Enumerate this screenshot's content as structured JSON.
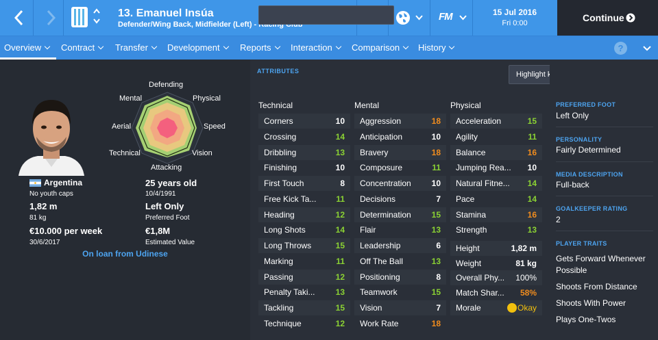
{
  "header": {
    "player_title": "13. Emanuel Insúa",
    "player_subtitle": "Defender/Wing Back, Midfielder (Left) - Racing Club",
    "date": "15 Jul 2016",
    "time": "Fri 0:00",
    "continue_label": "Continue",
    "fm_logo": "FM",
    "colors": {
      "header_bg": "#3f96e8",
      "accent": "#4da4f0",
      "orange": "#f08c1e",
      "green": "#8bd233"
    }
  },
  "nav": {
    "items": [
      "Overview",
      "Contract",
      "Transfer",
      "Development",
      "Reports",
      "Interaction",
      "Comparison",
      "History"
    ],
    "help": "?"
  },
  "profile": {
    "nationality": "Argentina",
    "youth_caps": "No youth caps",
    "height": "1,82 m",
    "weight": "81 kg",
    "wage": "€10.000 per week",
    "contract_end": "30/6/2017",
    "age": "25 years old",
    "dob": "10/4/1991",
    "preferred_foot": "Left Only",
    "preferred_foot_label": "Preferred Foot",
    "value": "€1,8M",
    "value_label": "Estimated Value",
    "loan": "On loan from Udinese"
  },
  "radar": {
    "labels": [
      "Defending",
      "Physical",
      "Speed",
      "Vision",
      "Attacking",
      "Technical",
      "Aerial",
      "Mental"
    ]
  },
  "attributes": {
    "section_title": "ATTRIBUTES",
    "highlight_button": "Highlight key attributes for role",
    "technical": {
      "title": "Technical",
      "rows": [
        {
          "name": "Corners",
          "value": "10"
        },
        {
          "name": "Crossing",
          "value": "14"
        },
        {
          "name": "Dribbling",
          "value": "13"
        },
        {
          "name": "Finishing",
          "value": "10"
        },
        {
          "name": "First Touch",
          "value": "8"
        },
        {
          "name": "Free Kick Ta...",
          "value": "11"
        },
        {
          "name": "Heading",
          "value": "12"
        },
        {
          "name": "Long Shots",
          "value": "14"
        },
        {
          "name": "Long Throws",
          "value": "15"
        },
        {
          "name": "Marking",
          "value": "11"
        },
        {
          "name": "Passing",
          "value": "12"
        },
        {
          "name": "Penalty Taki...",
          "value": "13"
        },
        {
          "name": "Tackling",
          "value": "15"
        },
        {
          "name": "Technique",
          "value": "12"
        }
      ]
    },
    "mental": {
      "title": "Mental",
      "rows": [
        {
          "name": "Aggression",
          "value": "18"
        },
        {
          "name": "Anticipation",
          "value": "10"
        },
        {
          "name": "Bravery",
          "value": "18"
        },
        {
          "name": "Composure",
          "value": "11"
        },
        {
          "name": "Concentration",
          "value": "10"
        },
        {
          "name": "Decisions",
          "value": "7"
        },
        {
          "name": "Determination",
          "value": "15"
        },
        {
          "name": "Flair",
          "value": "13"
        },
        {
          "name": "Leadership",
          "value": "6"
        },
        {
          "name": "Off The Ball",
          "value": "13"
        },
        {
          "name": "Positioning",
          "value": "8"
        },
        {
          "name": "Teamwork",
          "value": "15"
        },
        {
          "name": "Vision",
          "value": "7"
        },
        {
          "name": "Work Rate",
          "value": "18"
        }
      ]
    },
    "physical": {
      "title": "Physical",
      "rows": [
        {
          "name": "Acceleration",
          "value": "15"
        },
        {
          "name": "Agility",
          "value": "11"
        },
        {
          "name": "Balance",
          "value": "16"
        },
        {
          "name": "Jumping Rea...",
          "value": "10"
        },
        {
          "name": "Natural Fitne...",
          "value": "14"
        },
        {
          "name": "Pace",
          "value": "14"
        },
        {
          "name": "Stamina",
          "value": "16"
        },
        {
          "name": "Strength",
          "value": "13"
        }
      ],
      "extra": [
        {
          "name": "Height",
          "value": "1,82 m"
        },
        {
          "name": "Weight",
          "value": "81 kg"
        },
        {
          "name": "Overall Phy...",
          "value": "100%"
        },
        {
          "name": "Match Shar...",
          "value": "58%"
        },
        {
          "name": "Morale",
          "value": "Okay"
        }
      ]
    }
  },
  "info": {
    "preferred_foot_title": "PREFERRED FOOT",
    "preferred_foot": "Left Only",
    "personality_title": "PERSONALITY",
    "personality": "Fairly Determined",
    "media_title": "MEDIA DESCRIPTION",
    "media": "Full-back",
    "gk_title": "GOALKEEPER RATING",
    "gk": "2",
    "traits_title": "PLAYER TRAITS",
    "traits": [
      "Gets Forward Whenever Possible",
      "Shoots From Distance",
      "Shoots With Power",
      "Plays One-Twos"
    ]
  }
}
